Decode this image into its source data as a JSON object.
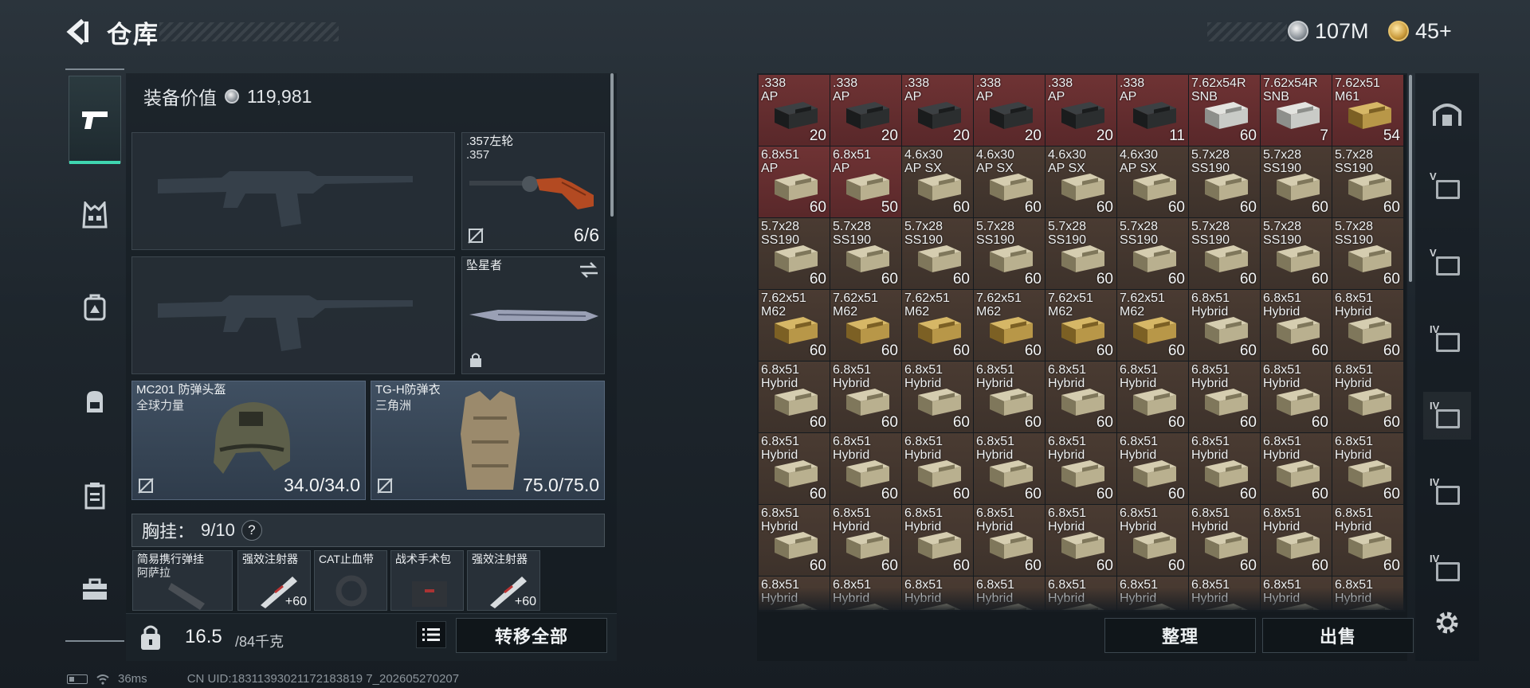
{
  "header": {
    "title": "仓库",
    "currency": [
      {
        "name": "silver",
        "value": "107M"
      },
      {
        "name": "gold",
        "value": "45+"
      }
    ]
  },
  "left_rail": [
    "weapons",
    "chest-rig",
    "backpack-alt",
    "backpack",
    "container",
    "toolbox"
  ],
  "loadout": {
    "value_label": "装备价值",
    "value": "119,981",
    "pistol": {
      "name": ".357左轮",
      "sub": ".357",
      "count": "6/6"
    },
    "melee": {
      "name": "坠星者"
    },
    "helmet": {
      "name": "MC201 防弹头盔",
      "sub": "全球力量",
      "durability": "34.0/34.0"
    },
    "armor": {
      "name": "TG-H防弹衣",
      "sub": "三角洲",
      "durability": "75.0/75.0"
    },
    "rig": {
      "label": "胸挂：",
      "count": "9/10",
      "help": "?"
    },
    "rig_items": [
      {
        "name": "简易携行弹挂",
        "sub": "阿萨拉"
      },
      {
        "name": "强效注射器",
        "sub": ""
      },
      {
        "name": "CAT止血带",
        "sub": ""
      },
      {
        "name": "战术手术包",
        "sub": ""
      },
      {
        "name": "强效注射器",
        "sub": ""
      }
    ],
    "weight": "16.5",
    "weight_max": "/84千克",
    "transfer_all": "转移全部"
  },
  "stash": {
    "items": [
      {
        "label": ".338\nAP",
        "qty": "20",
        "tier": "red",
        "box": "dark"
      },
      {
        "label": ".338\nAP",
        "qty": "20",
        "tier": "red",
        "box": "dark"
      },
      {
        "label": ".338\nAP",
        "qty": "20",
        "tier": "red",
        "box": "dark"
      },
      {
        "label": ".338\nAP",
        "qty": "20",
        "tier": "red",
        "box": "dark"
      },
      {
        "label": ".338\nAP",
        "qty": "20",
        "tier": "red",
        "box": "dark"
      },
      {
        "label": ".338\nAP",
        "qty": "11",
        "tier": "red",
        "box": "dark"
      },
      {
        "label": "7.62x54R\nSNB",
        "qty": "60",
        "tier": "red",
        "box": "white"
      },
      {
        "label": "7.62x54R\nSNB",
        "qty": "7",
        "tier": "red",
        "box": "white"
      },
      {
        "label": "7.62x51\nM61",
        "qty": "54",
        "tier": "red",
        "box": "gold"
      },
      {
        "label": "6.8x51\nAP",
        "qty": "60",
        "tier": "red",
        "box": "beige"
      },
      {
        "label": "6.8x51\nAP",
        "qty": "50",
        "tier": "red",
        "box": "beige"
      },
      {
        "label": "4.6x30\nAP SX",
        "qty": "60",
        "tier": "brown",
        "box": "beige"
      },
      {
        "label": "4.6x30\nAP SX",
        "qty": "60",
        "tier": "brown",
        "box": "beige"
      },
      {
        "label": "4.6x30\nAP SX",
        "qty": "60",
        "tier": "brown",
        "box": "beige"
      },
      {
        "label": "4.6x30\nAP SX",
        "qty": "60",
        "tier": "brown",
        "box": "beige"
      },
      {
        "label": "5.7x28\nSS190",
        "qty": "60",
        "tier": "brown",
        "box": "beige"
      },
      {
        "label": "5.7x28\nSS190",
        "qty": "60",
        "tier": "brown",
        "box": "beige"
      },
      {
        "label": "5.7x28\nSS190",
        "qty": "60",
        "tier": "brown",
        "box": "beige"
      },
      {
        "label": "5.7x28\nSS190",
        "qty": "60",
        "tier": "brown",
        "box": "beige"
      },
      {
        "label": "5.7x28\nSS190",
        "qty": "60",
        "tier": "brown",
        "box": "beige"
      },
      {
        "label": "5.7x28\nSS190",
        "qty": "60",
        "tier": "brown",
        "box": "beige"
      },
      {
        "label": "5.7x28\nSS190",
        "qty": "60",
        "tier": "brown",
        "box": "beige"
      },
      {
        "label": "5.7x28\nSS190",
        "qty": "60",
        "tier": "brown",
        "box": "beige"
      },
      {
        "label": "5.7x28\nSS190",
        "qty": "60",
        "tier": "brown",
        "box": "beige"
      },
      {
        "label": "5.7x28\nSS190",
        "qty": "60",
        "tier": "brown",
        "box": "beige"
      },
      {
        "label": "5.7x28\nSS190",
        "qty": "60",
        "tier": "brown",
        "box": "beige"
      },
      {
        "label": "5.7x28\nSS190",
        "qty": "60",
        "tier": "brown",
        "box": "beige"
      },
      {
        "label": "7.62x51\nM62",
        "qty": "60",
        "tier": "brown",
        "box": "gold"
      },
      {
        "label": "7.62x51\nM62",
        "qty": "60",
        "tier": "brown",
        "box": "gold"
      },
      {
        "label": "7.62x51\nM62",
        "qty": "60",
        "tier": "brown",
        "box": "gold"
      },
      {
        "label": "7.62x51\nM62",
        "qty": "60",
        "tier": "brown",
        "box": "gold"
      },
      {
        "label": "7.62x51\nM62",
        "qty": "60",
        "tier": "brown",
        "box": "gold"
      },
      {
        "label": "7.62x51\nM62",
        "qty": "60",
        "tier": "brown",
        "box": "gold"
      },
      {
        "label": "6.8x51\nHybrid",
        "qty": "60",
        "tier": "brown",
        "box": "beige"
      },
      {
        "label": "6.8x51\nHybrid",
        "qty": "60",
        "tier": "brown",
        "box": "beige"
      },
      {
        "label": "6.8x51\nHybrid",
        "qty": "60",
        "tier": "brown",
        "box": "beige"
      },
      {
        "label": "6.8x51\nHybrid",
        "qty": "60",
        "tier": "brown",
        "box": "beige"
      },
      {
        "label": "6.8x51\nHybrid",
        "qty": "60",
        "tier": "brown",
        "box": "beige"
      },
      {
        "label": "6.8x51\nHybrid",
        "qty": "60",
        "tier": "brown",
        "box": "beige"
      },
      {
        "label": "6.8x51\nHybrid",
        "qty": "60",
        "tier": "brown",
        "box": "beige"
      },
      {
        "label": "6.8x51\nHybrid",
        "qty": "60",
        "tier": "brown",
        "box": "beige"
      },
      {
        "label": "6.8x51\nHybrid",
        "qty": "60",
        "tier": "brown",
        "box": "beige"
      },
      {
        "label": "6.8x51\nHybrid",
        "qty": "60",
        "tier": "brown",
        "box": "beige"
      },
      {
        "label": "6.8x51\nHybrid",
        "qty": "60",
        "tier": "brown",
        "box": "beige"
      },
      {
        "label": "6.8x51\nHybrid",
        "qty": "60",
        "tier": "brown",
        "box": "beige"
      },
      {
        "label": "6.8x51\nHybrid",
        "qty": "60",
        "tier": "brown",
        "box": "beige"
      },
      {
        "label": "6.8x51\nHybrid",
        "qty": "60",
        "tier": "brown",
        "box": "beige"
      },
      {
        "label": "6.8x51\nHybrid",
        "qty": "60",
        "tier": "brown",
        "box": "beige"
      },
      {
        "label": "6.8x51\nHybrid",
        "qty": "60",
        "tier": "brown",
        "box": "beige"
      },
      {
        "label": "6.8x51\nHybrid",
        "qty": "60",
        "tier": "brown",
        "box": "beige"
      },
      {
        "label": "6.8x51\nHybrid",
        "qty": "60",
        "tier": "brown",
        "box": "beige"
      },
      {
        "label": "6.8x51\nHybrid",
        "qty": "60",
        "tier": "brown",
        "box": "beige"
      },
      {
        "label": "6.8x51\nHybrid",
        "qty": "60",
        "tier": "brown",
        "box": "beige"
      },
      {
        "label": "6.8x51\nHybrid",
        "qty": "60",
        "tier": "brown",
        "box": "beige"
      },
      {
        "label": "6.8x51\nHybrid",
        "qty": "60",
        "tier": "brown",
        "box": "beige"
      },
      {
        "label": "6.8x51\nHybrid",
        "qty": "60",
        "tier": "brown",
        "box": "beige"
      },
      {
        "label": "6.8x51\nHybrid",
        "qty": "60",
        "tier": "brown",
        "box": "beige"
      },
      {
        "label": "6.8x51\nHybrid",
        "qty": "60",
        "tier": "brown",
        "box": "beige"
      },
      {
        "label": "6.8x51\nHybrid",
        "qty": "60",
        "tier": "brown",
        "box": "beige"
      },
      {
        "label": "6.8x51\nHybrid",
        "qty": "60",
        "tier": "brown",
        "box": "beige"
      },
      {
        "label": "6.8x51\nHybrid",
        "qty": "60",
        "tier": "brown",
        "box": "beige"
      },
      {
        "label": "6.8x51\nHybrid",
        "qty": "60",
        "tier": "brown",
        "box": "beige"
      },
      {
        "label": "6.8x51\nHybrid",
        "qty": "60",
        "tier": "brown",
        "box": "beige"
      },
      {
        "label": "6.8x51\nHybrid",
        "qty": "",
        "tier": "brown",
        "box": "beige"
      },
      {
        "label": "6.8x51\nHybrid",
        "qty": "",
        "tier": "brown",
        "box": "beige"
      },
      {
        "label": "6.8x51\nHybrid",
        "qty": "",
        "tier": "brown",
        "box": "beige"
      },
      {
        "label": "6.8x51\nHybrid",
        "qty": "",
        "tier": "brown",
        "box": "beige"
      },
      {
        "label": "6.8x51\nHybrid",
        "qty": "",
        "tier": "brown",
        "box": "beige"
      },
      {
        "label": "6.8x51\nHybrid",
        "qty": "",
        "tier": "brown",
        "box": "beige"
      },
      {
        "label": "6.8x51\nHybrid",
        "qty": "",
        "tier": "brown",
        "box": "beige"
      },
      {
        "label": "6.8x51\nHybrid",
        "qty": "",
        "tier": "brown",
        "box": "beige"
      },
      {
        "label": "6.8x51\nHybrid",
        "qty": "",
        "tier": "brown",
        "box": "beige"
      }
    ],
    "sort_btn": "整理",
    "sell_btn": "出售"
  },
  "right_rail": [
    {
      "name": "stash-main-icon",
      "label": ""
    },
    {
      "name": "stash-v-1-icon",
      "label": "V"
    },
    {
      "name": "stash-v-2-icon",
      "label": "V"
    },
    {
      "name": "stash-iv-1-icon",
      "label": "IV"
    },
    {
      "name": "stash-iv-2-icon",
      "label": "IV"
    },
    {
      "name": "stash-iv-add-icon",
      "label": "IV"
    },
    {
      "name": "stash-iv-3-icon",
      "label": "IV"
    }
  ],
  "status": {
    "ping": "36ms",
    "uid": "CN UID:18311393021172183819 7_202605270207"
  },
  "colors": {
    "accent": "#3fd6b0",
    "red_tier": "#6f3334",
    "brown_tier": "#4a3b32"
  }
}
